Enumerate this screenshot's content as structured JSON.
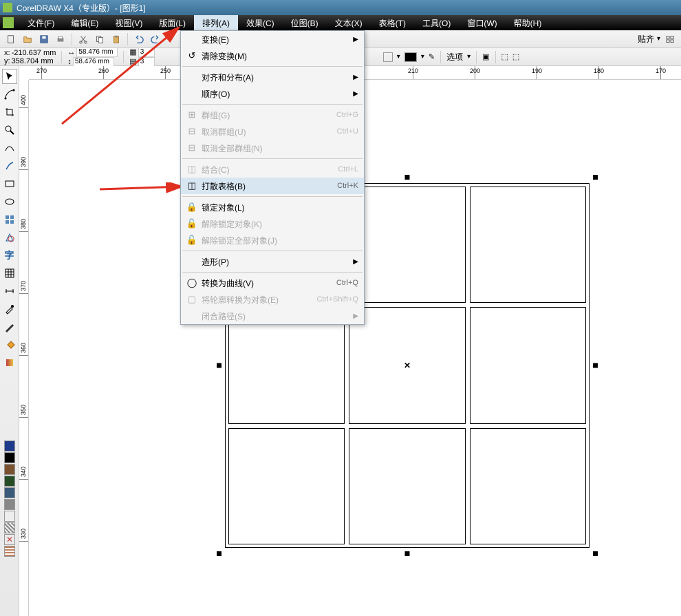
{
  "title": "CorelDRAW X4（专业版）- [图形1]",
  "menubar": [
    "文件(F)",
    "编辑(E)",
    "视图(V)",
    "版面(L)",
    "排列(A)",
    "效果(C)",
    "位图(B)",
    "文本(X)",
    "表格(T)",
    "工具(O)",
    "窗口(W)",
    "帮助(H)"
  ],
  "active_menu_index": 4,
  "toolbar2": {
    "x_label": "x:",
    "y_label": "y:",
    "x_value": "-210.637 mm",
    "y_value": "358.704 mm",
    "w_value": "58.476 mm",
    "h_value": "58.476 mm",
    "cols_value": "3",
    "rows_value": "3",
    "snap_label": "贴齐",
    "options_label": "选项"
  },
  "ruler_h": [
    "270",
    "260",
    "250",
    "210",
    "200",
    "190",
    "180",
    "170"
  ],
  "ruler_h_pos": [
    18,
    108,
    198,
    558,
    648,
    738,
    828,
    918
  ],
  "ruler_v": [
    "400",
    "390",
    "380",
    "370",
    "360",
    "350",
    "340",
    "330"
  ],
  "dropdown": {
    "groups": [
      [
        {
          "label": "变换(E)",
          "shortcut": "",
          "icon": "",
          "submenu": true,
          "disabled": false
        },
        {
          "label": "清除变换(M)",
          "shortcut": "",
          "icon": "clear",
          "submenu": false,
          "disabled": false
        }
      ],
      [
        {
          "label": "对齐和分布(A)",
          "shortcut": "",
          "icon": "",
          "submenu": true,
          "disabled": false
        },
        {
          "label": "顺序(O)",
          "shortcut": "",
          "icon": "",
          "submenu": true,
          "disabled": false
        }
      ],
      [
        {
          "label": "群组(G)",
          "shortcut": "Ctrl+G",
          "icon": "group",
          "submenu": false,
          "disabled": true
        },
        {
          "label": "取消群组(U)",
          "shortcut": "Ctrl+U",
          "icon": "ungroup",
          "submenu": false,
          "disabled": true
        },
        {
          "label": "取消全部群组(N)",
          "shortcut": "",
          "icon": "ungroupall",
          "submenu": false,
          "disabled": true
        }
      ],
      [
        {
          "label": "结合(C)",
          "shortcut": "Ctrl+L",
          "icon": "combine",
          "submenu": false,
          "disabled": true
        },
        {
          "label": "打散表格(B)",
          "shortcut": "Ctrl+K",
          "icon": "break",
          "submenu": false,
          "disabled": false,
          "highlighted": true
        }
      ],
      [
        {
          "label": "锁定对象(L)",
          "shortcut": "",
          "icon": "lock",
          "submenu": false,
          "disabled": false
        },
        {
          "label": "解除锁定对象(K)",
          "shortcut": "",
          "icon": "unlock",
          "submenu": false,
          "disabled": true
        },
        {
          "label": "解除锁定全部对象(J)",
          "shortcut": "",
          "icon": "unlockall",
          "submenu": false,
          "disabled": true
        }
      ],
      [
        {
          "label": "造形(P)",
          "shortcut": "",
          "icon": "",
          "submenu": true,
          "disabled": false
        }
      ],
      [
        {
          "label": "转换为曲线(V)",
          "shortcut": "Ctrl+Q",
          "icon": "curve",
          "submenu": false,
          "disabled": false
        },
        {
          "label": "将轮廓转换为对象(E)",
          "shortcut": "Ctrl+Shift+Q",
          "icon": "outline",
          "submenu": false,
          "disabled": true
        },
        {
          "label": "闭合路径(S)",
          "shortcut": "",
          "icon": "",
          "submenu": true,
          "disabled": true
        }
      ]
    ]
  },
  "palette": [
    "#1e3a8a",
    "#000000",
    "#7a5230",
    "#264d26",
    "#3a5a7a",
    "#888888",
    "#eeeeee"
  ],
  "palette_special": [
    "striped",
    "x",
    "pattern"
  ]
}
